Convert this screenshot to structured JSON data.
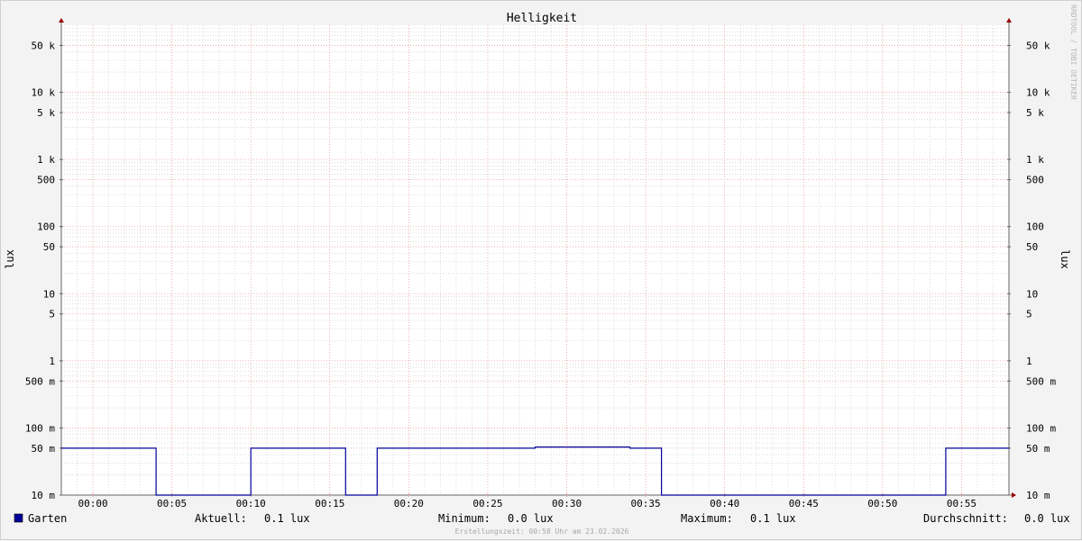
{
  "chart_data": {
    "type": "line",
    "title": "Helligkeit",
    "ylabel": "lux",
    "y_scale": "log",
    "ylim": [
      0.01,
      100000
    ],
    "y_ticks": [
      {
        "value": 50000,
        "label": "50 k"
      },
      {
        "value": 10000,
        "label": "10 k"
      },
      {
        "value": 5000,
        "label": "5 k"
      },
      {
        "value": 1000,
        "label": "1 k"
      },
      {
        "value": 500,
        "label": "500"
      },
      {
        "value": 100,
        "label": "100"
      },
      {
        "value": 50,
        "label": "50"
      },
      {
        "value": 10,
        "label": "10"
      },
      {
        "value": 5,
        "label": "5"
      },
      {
        "value": 1,
        "label": "1"
      },
      {
        "value": 0.5,
        "label": "500 m"
      },
      {
        "value": 0.1,
        "label": "100 m"
      },
      {
        "value": 0.05,
        "label": "50 m"
      },
      {
        "value": 0.01,
        "label": "10 m"
      }
    ],
    "xlim": [
      "23:58",
      "00:58"
    ],
    "x_ticks": [
      {
        "value": "00:00",
        "label": "00:00"
      },
      {
        "value": "00:05",
        "label": "00:05"
      },
      {
        "value": "00:10",
        "label": "00:10"
      },
      {
        "value": "00:15",
        "label": "00:15"
      },
      {
        "value": "00:20",
        "label": "00:20"
      },
      {
        "value": "00:25",
        "label": "00:25"
      },
      {
        "value": "00:30",
        "label": "00:30"
      },
      {
        "value": "00:35",
        "label": "00:35"
      },
      {
        "value": "00:40",
        "label": "00:40"
      },
      {
        "value": "00:45",
        "label": "00:45"
      },
      {
        "value": "00:50",
        "label": "00:50"
      },
      {
        "value": "00:55",
        "label": "00:55"
      }
    ],
    "grid": true,
    "series": [
      {
        "name": "Garten",
        "color": "#000099",
        "points": [
          {
            "t": "23:58",
            "v": 0.05
          },
          {
            "t": "00:04",
            "v": 0.05
          },
          {
            "t": "00:04",
            "v": 0.01
          },
          {
            "t": "00:10",
            "v": 0.01
          },
          {
            "t": "00:10",
            "v": 0.05
          },
          {
            "t": "00:16",
            "v": 0.05
          },
          {
            "t": "00:16",
            "v": 0.01
          },
          {
            "t": "00:18",
            "v": 0.01
          },
          {
            "t": "00:18",
            "v": 0.05
          },
          {
            "t": "00:28",
            "v": 0.05
          },
          {
            "t": "00:28",
            "v": 0.052
          },
          {
            "t": "00:34",
            "v": 0.052
          },
          {
            "t": "00:34",
            "v": 0.05
          },
          {
            "t": "00:36",
            "v": 0.05
          },
          {
            "t": "00:36",
            "v": 0.01
          },
          {
            "t": "00:54",
            "v": 0.01
          },
          {
            "t": "00:54",
            "v": 0.05
          },
          {
            "t": "00:58",
            "v": 0.05
          }
        ]
      }
    ],
    "legend_position": "bottom"
  },
  "legend": {
    "series_name": "Garten",
    "swatch_color": "#000099",
    "current_label": "Aktuell:",
    "current_value": "0.1 lux",
    "min_label": "Minimum:",
    "min_value": "0.0 lux",
    "max_label": "Maximum:",
    "max_value": "0.1 lux",
    "avg_label": "Durchschnitt:",
    "avg_value": "0.0 lux"
  },
  "footer": {
    "created": "Erstellungszeit: 00:58 Uhr am 23.02.2026"
  },
  "watermark": "RRDTOOL / TOBI OETIKER",
  "colors": {
    "background": "#f3f3f3",
    "canvas": "#ffffff",
    "minor_grid": "#d4d4d4",
    "major_grid": "#e8a0a0",
    "axis": "#666666",
    "arrow": "#990000",
    "line": "#000099"
  }
}
